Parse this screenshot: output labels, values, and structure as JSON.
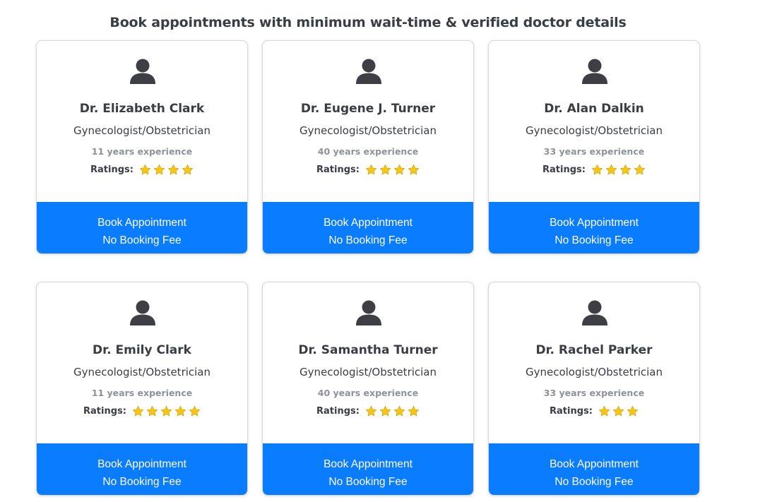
{
  "header": {
    "title": "Book appointments with minimum wait-time & verified doctor details"
  },
  "doctors": [
    {
      "name": "Dr. Elizabeth Clark",
      "specialty": "Gynecologist/Obstetrician",
      "experience": "11 years experience",
      "ratings_label": "Ratings:",
      "rating": 4,
      "button_line1": "Book Appointment",
      "button_line2": "No Booking Fee"
    },
    {
      "name": "Dr. Eugene J. Turner",
      "specialty": "Gynecologist/Obstetrician",
      "experience": "40 years experience",
      "ratings_label": "Ratings:",
      "rating": 4,
      "button_line1": "Book Appointment",
      "button_line2": "No Booking Fee"
    },
    {
      "name": "Dr. Alan Dalkin",
      "specialty": "Gynecologist/Obstetrician",
      "experience": "33 years experience",
      "ratings_label": "Ratings:",
      "rating": 4,
      "button_line1": "Book Appointment",
      "button_line2": "No Booking Fee"
    },
    {
      "name": "Dr. Emily Clark",
      "specialty": "Gynecologist/Obstetrician",
      "experience": "11 years experience",
      "ratings_label": "Ratings:",
      "rating": 5,
      "button_line1": "Book Appointment",
      "button_line2": "No Booking Fee"
    },
    {
      "name": "Dr. Samantha Turner",
      "specialty": "Gynecologist/Obstetrician",
      "experience": "40 years experience",
      "ratings_label": "Ratings:",
      "rating": 4,
      "button_line1": "Book Appointment",
      "button_line2": "No Booking Fee"
    },
    {
      "name": "Dr. Rachel Parker",
      "specialty": "Gynecologist/Obstetrician",
      "experience": "33 years experience",
      "ratings_label": "Ratings:",
      "rating": 3,
      "button_line1": "Book Appointment",
      "button_line2": "No Booking Fee"
    }
  ],
  "icons": {
    "avatar": "user-silhouette-icon",
    "star": "star-icon"
  },
  "colors": {
    "accent": "#0a7cff",
    "text": "#3a3d42",
    "muted": "#8f9296",
    "star": "#f5c518"
  }
}
